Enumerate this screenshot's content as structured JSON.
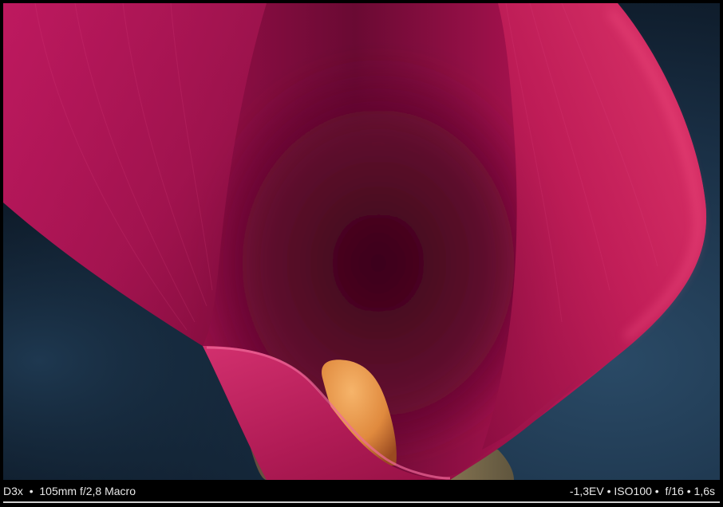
{
  "caption": {
    "camera": "D3x",
    "separator": "•",
    "lens": "105mm f/2,8 Macro",
    "exposure_compensation": "-1,3EV",
    "iso": "ISO100",
    "aperture": "f/16",
    "shutter": "1,6s"
  },
  "photo": {
    "subject": "calla-lily",
    "colors": {
      "background_dark": "#0c1826",
      "background_blue": "#1f3a52",
      "petal_magenta": "#c2175d",
      "petal_highlight": "#e0407e",
      "petal_shadow": "#4a0824",
      "spadix_orange": "#e89a4c"
    }
  }
}
